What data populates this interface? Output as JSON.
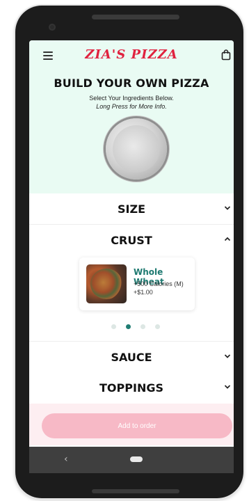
{
  "app": {
    "brand": "ZIA'S PIZZA"
  },
  "hero": {
    "title": "BUILD YOUR OWN PIZZA",
    "subtitle": "Select Your Ingredients Below.",
    "hint": "Long Press for More Info."
  },
  "sections": {
    "size": "SIZE",
    "crust": "CRUST",
    "sauce": "SAUCE",
    "toppings": "TOPPINGS"
  },
  "crust_option": {
    "name": "Whole Wheat",
    "calories": "+500 Calories (M)",
    "price": "+$1.00"
  },
  "carousel": {
    "total": 4,
    "active_index": 1
  },
  "actions": {
    "add_to_order": "Add to order"
  },
  "icons": {
    "menu": "hamburger-menu-icon",
    "bag": "shopping-bag-icon",
    "chevron_down": "chevron-down-icon",
    "chevron_up": "chevron-up-icon",
    "back": "nav-back-icon",
    "home": "nav-home-icon"
  },
  "colors": {
    "brand_red": "#e0223f",
    "mint_background": "#e9fbf3",
    "accent_teal": "#1f7a71",
    "button_pink": "#f7b9c6"
  }
}
